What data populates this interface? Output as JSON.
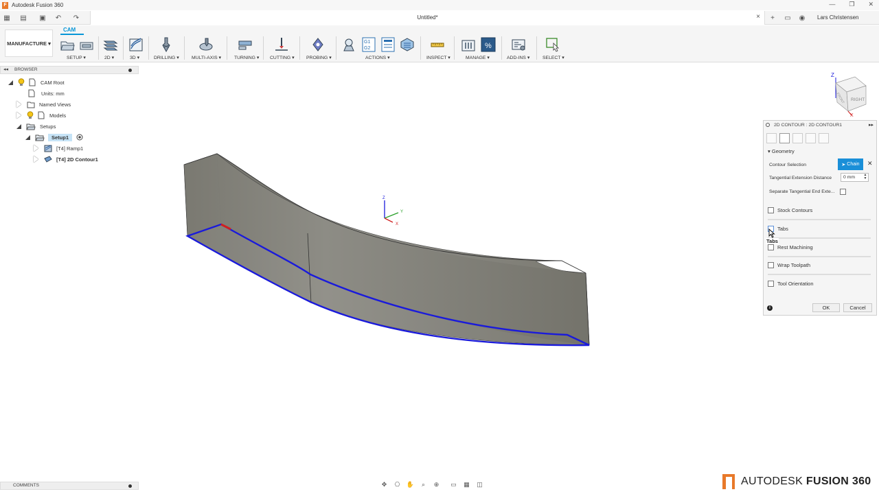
{
  "app": {
    "title": "Autodesk Fusion 360",
    "logo_letter": "F"
  },
  "window_controls": [
    "—",
    "❐",
    "✕"
  ],
  "document": {
    "tab_title": "Untitled*",
    "close": "×"
  },
  "user": {
    "name": "Lars Christensen"
  },
  "toolbar": {
    "workspace": "MANUFACTURE ▾",
    "active_tab": "CAM",
    "groups": [
      {
        "label": "SETUP ▾"
      },
      {
        "label": "2D ▾"
      },
      {
        "label": "3D ▾"
      },
      {
        "label": "DRILLING ▾"
      },
      {
        "label": "MULTI-AXIS ▾"
      },
      {
        "label": "TURNING ▾"
      },
      {
        "label": "CUTTING ▾"
      },
      {
        "label": "PROBING ▾"
      },
      {
        "label": "ACTIONS ▾"
      },
      {
        "label": "INSPECT ▾"
      },
      {
        "label": "MANAGE ▾"
      },
      {
        "label": "ADD-INS ▾"
      },
      {
        "label": "SELECT ▾"
      }
    ],
    "actions_icon_text": "G1\nG2"
  },
  "browser": {
    "header": "BROWSER",
    "items": [
      {
        "label": "CAM Root"
      },
      {
        "label": "Units: mm"
      },
      {
        "label": "Named Views"
      },
      {
        "label": "Models"
      },
      {
        "label": "Setups"
      },
      {
        "label": "Setup1"
      },
      {
        "label": "[T4] Ramp1"
      },
      {
        "label": "[T4] 2D Contour1"
      }
    ]
  },
  "comments": {
    "header": "COMMENTS"
  },
  "viewcube": {
    "labels": {
      "top": "Z",
      "front": "FRONT",
      "right": "RIGHT",
      "x": "X"
    }
  },
  "triad": {
    "z": "Z",
    "y": "Y",
    "x": "X"
  },
  "dialog": {
    "title": "2D CONTOUR : 2D CONTOUR1",
    "geometry_header": "Geometry",
    "contour_selection_label": "Contour Selection",
    "chain_button": "Chain",
    "tangential_label": "Tangential Extension Distance",
    "tangential_value": "0 mm",
    "separate_label": "Separate Tangential End Exte...",
    "groups": [
      {
        "label": "Stock Contours"
      },
      {
        "label": "Tabs"
      },
      {
        "label": "Rest Machining"
      },
      {
        "label": "Wrap Toolpath"
      },
      {
        "label": "Tool Orientation"
      }
    ],
    "tooltip": "Tabs",
    "ok": "OK",
    "cancel": "Cancel",
    "info": "i"
  },
  "brand": {
    "prefix": "AUTODESK",
    "product": "FUSION 360"
  },
  "colors": {
    "accent": "#0696d7",
    "chain_button": "#1a8fd8",
    "selection_contour": "#1a1adb",
    "part_body": "#85847c",
    "brand_orange": "#e8792a"
  }
}
